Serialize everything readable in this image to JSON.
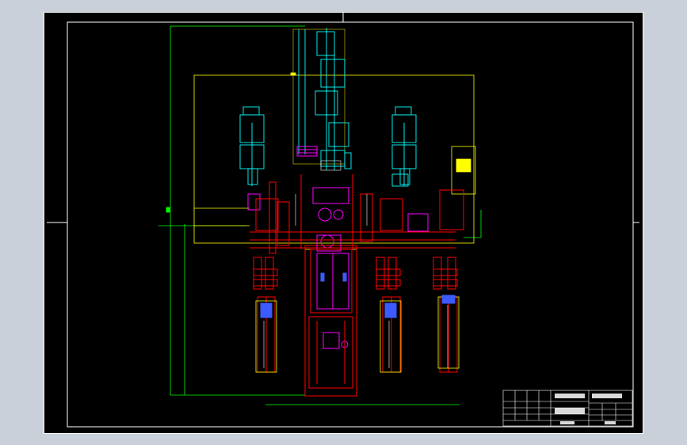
{
  "colors": {
    "background": "#c9d0da",
    "paper": "#000000",
    "frame": "#ffffff",
    "dimension": "#00ff00",
    "outline": "#ffff00",
    "motor": "#00ffff",
    "frame_red": "#ff0000",
    "magenta": "#ff00ff",
    "blue": "#3b5bff"
  },
  "title_block": {
    "title": "",
    "drawing_no": "",
    "scale": "",
    "designer": ""
  }
}
